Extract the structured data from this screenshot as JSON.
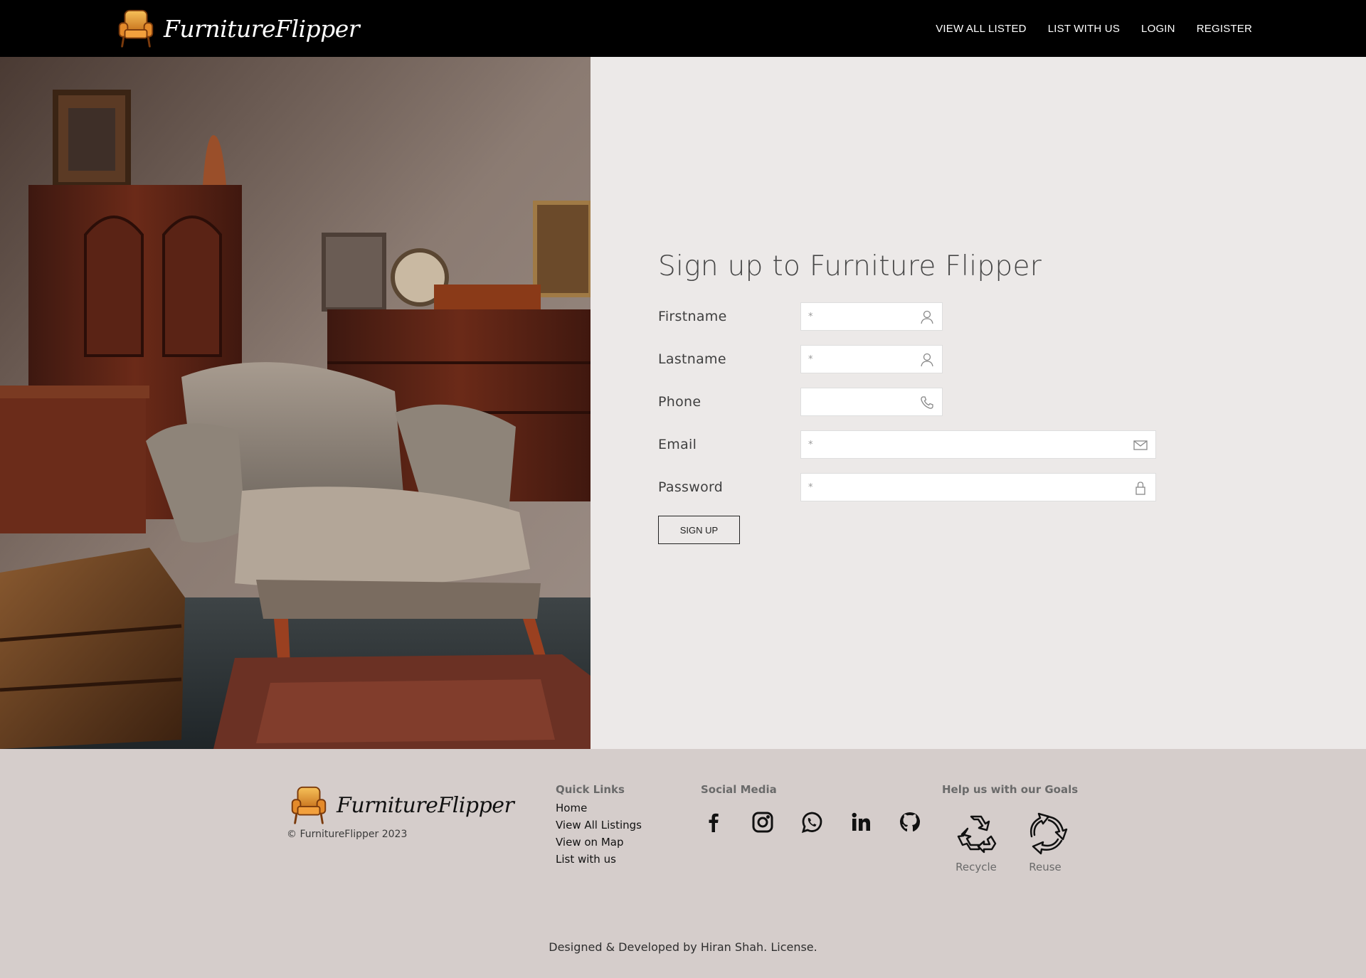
{
  "navbar": {
    "brand": "FurnitureFlipper",
    "links": [
      "VIEW ALL LISTED",
      "LIST WITH US",
      "LOGIN",
      "REGISTER"
    ]
  },
  "form": {
    "title": "Sign up to Furniture Flipper",
    "fields": [
      {
        "label": "Firstname",
        "placeholder": "*",
        "icon": "user-icon"
      },
      {
        "label": "Lastname",
        "placeholder": "*",
        "icon": "user-icon"
      },
      {
        "label": "Phone",
        "placeholder": "",
        "icon": "phone-icon"
      },
      {
        "label": "Email",
        "placeholder": "*",
        "icon": "envelope-icon"
      },
      {
        "label": "Password",
        "placeholder": "*",
        "icon": "lock-icon"
      }
    ],
    "submit_label": "SIGN UP"
  },
  "footer": {
    "brand": "FurnitureFlipper",
    "copyright": "© FurnitureFlipper 2023",
    "quick_links_heading": "Quick Links",
    "quick_links": [
      "Home",
      "View All Listings",
      "View on Map",
      "List with us"
    ],
    "social_heading": "Social Media",
    "social_icons": [
      "facebook-icon",
      "instagram-icon",
      "whatsapp-icon",
      "linkedin-icon",
      "github-icon"
    ],
    "goals_heading": "Help us with our Goals",
    "goals": [
      "Recycle",
      "Reuse"
    ],
    "credits_prefix": "Designed & Developed by Hiran Shah.",
    "credits_link": "License."
  }
}
